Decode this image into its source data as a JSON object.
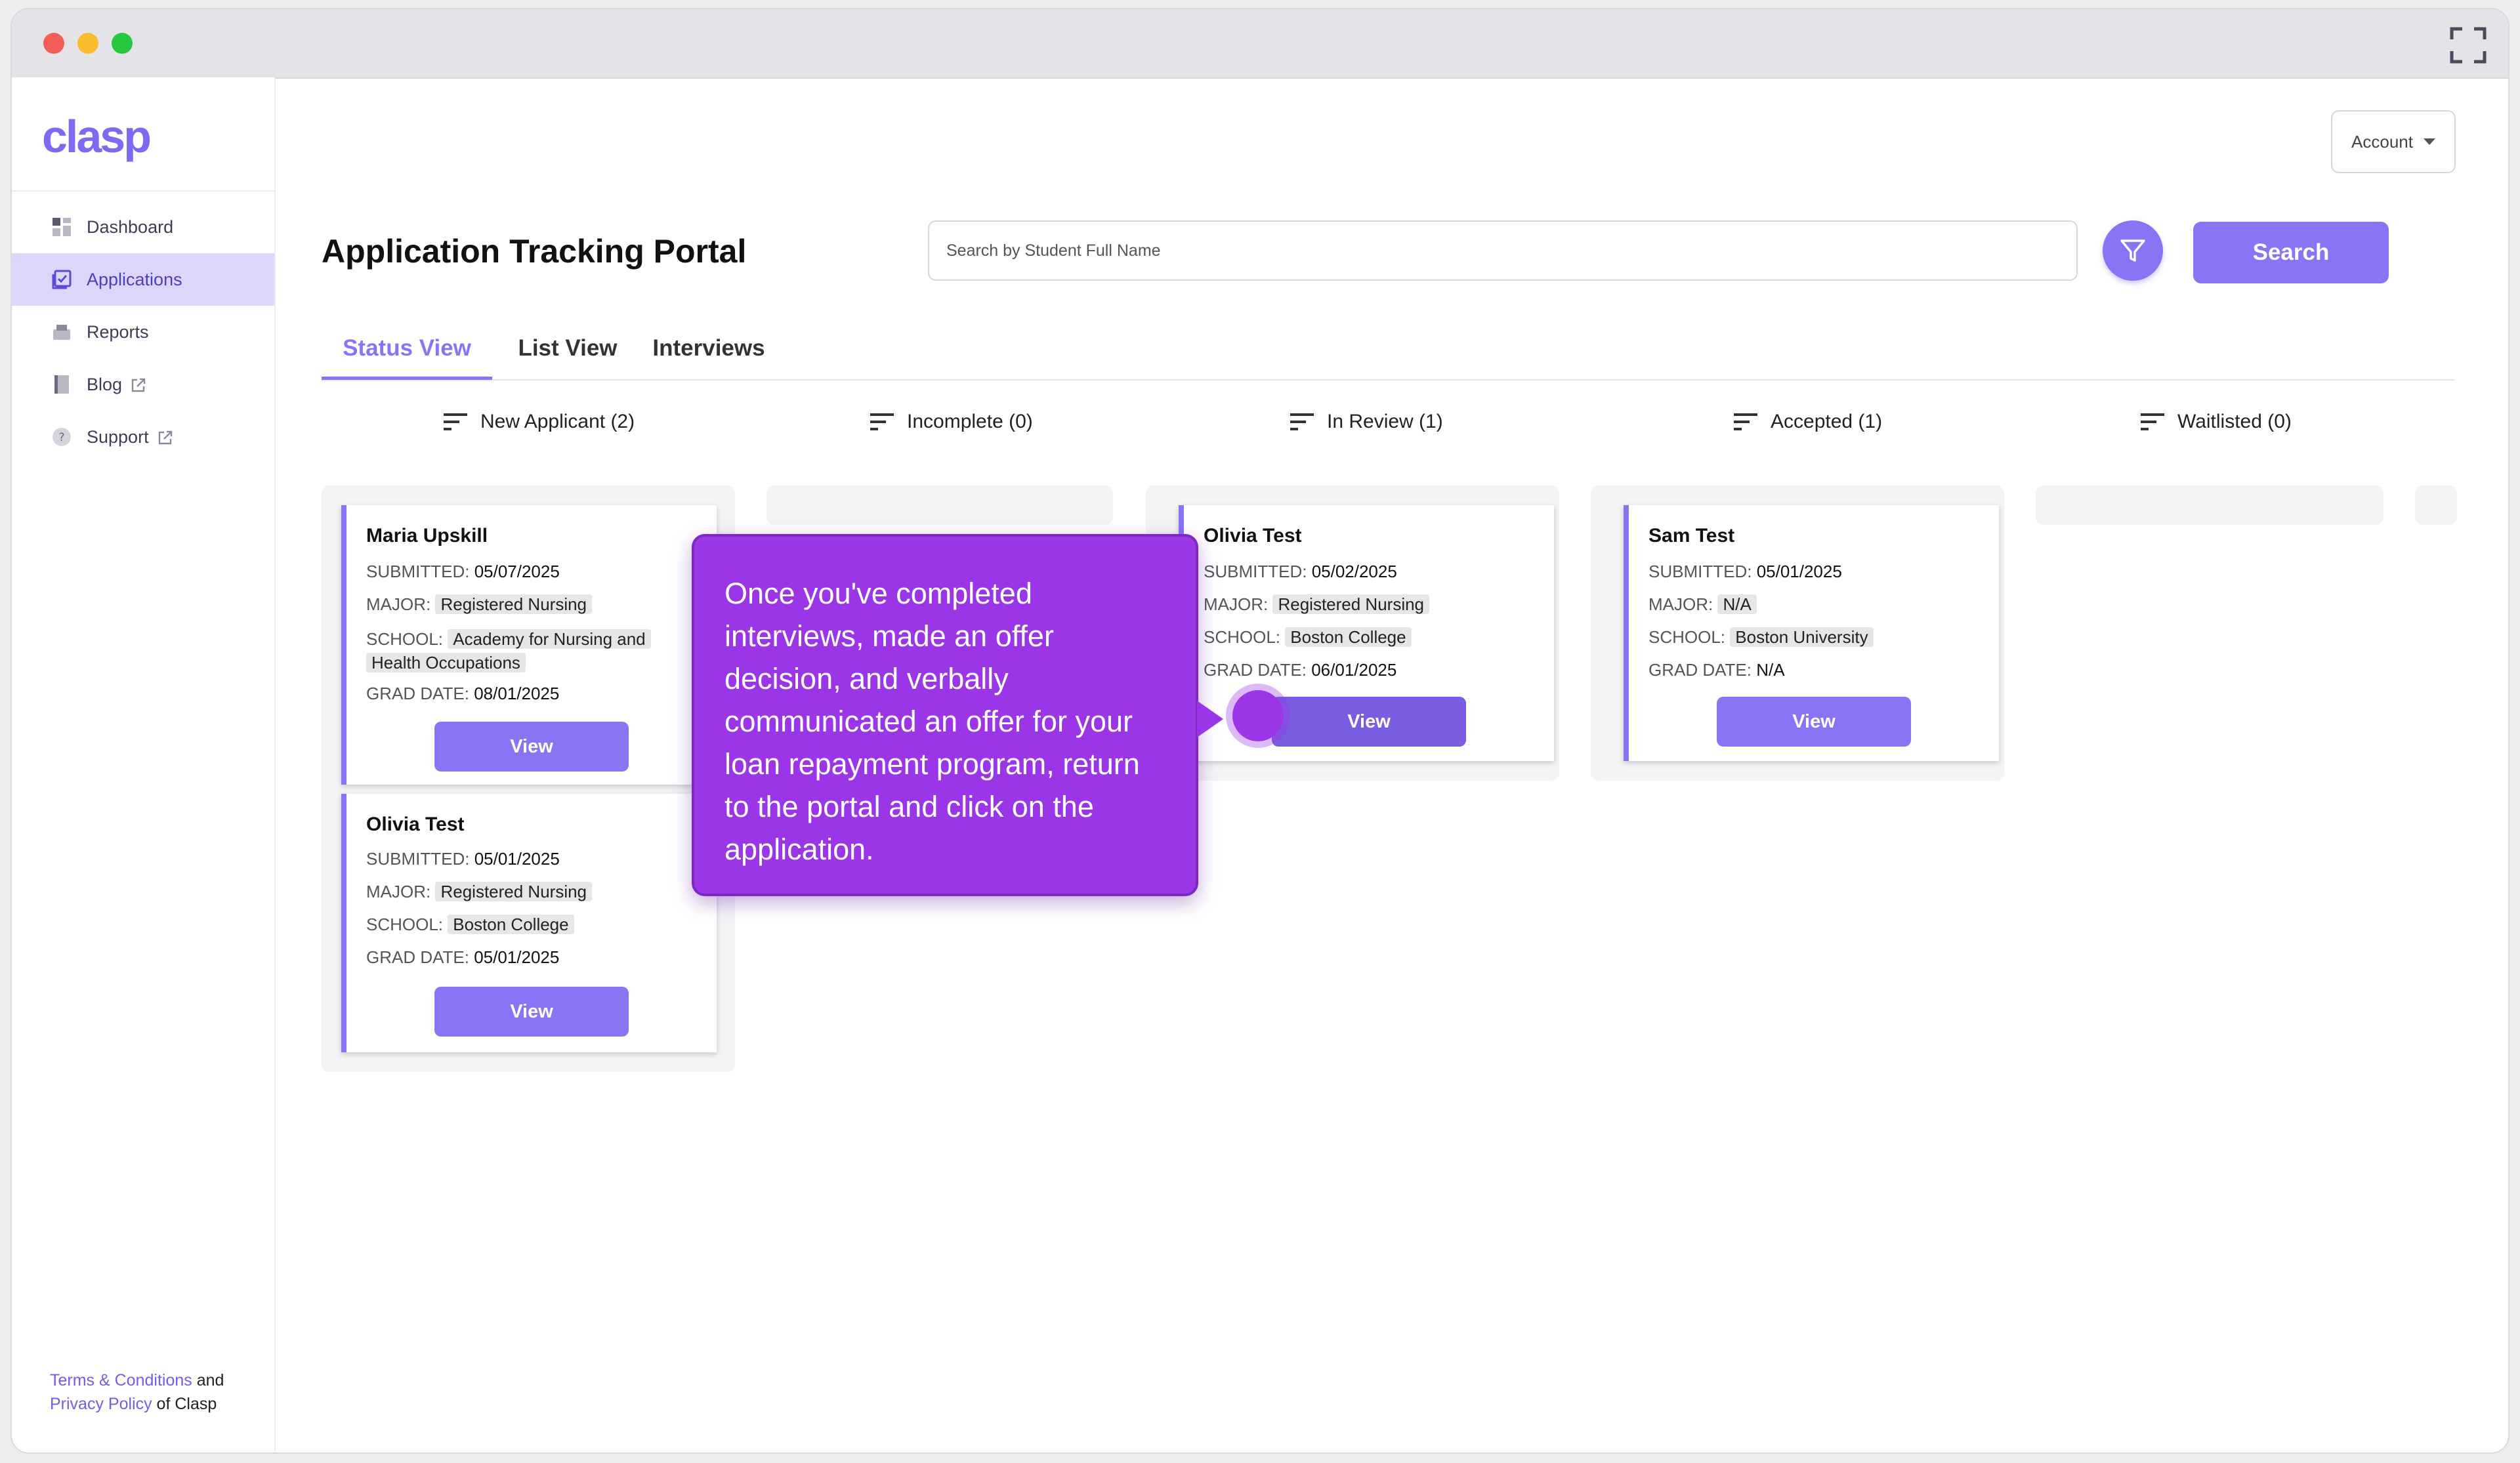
{
  "brand": {
    "logo": "clasp",
    "accent": "#8a73f5"
  },
  "window": {
    "dots": [
      "#f35f57",
      "#f7bd2e",
      "#27c840"
    ]
  },
  "sidebar": {
    "items": [
      {
        "label": "Dashboard",
        "icon": "dashboard-icon"
      },
      {
        "label": "Applications",
        "icon": "applications-icon",
        "active": true
      },
      {
        "label": "Reports",
        "icon": "reports-icon"
      },
      {
        "label": "Blog",
        "icon": "blog-icon",
        "external": true
      },
      {
        "label": "Support",
        "icon": "support-icon",
        "external": true
      }
    ],
    "footer": {
      "terms": "Terms & Conditions",
      "and": "and",
      "privacy": "Privacy Policy",
      "suffix": "of Clasp"
    }
  },
  "header": {
    "account_label": "Account",
    "title": "Application Tracking Portal",
    "search_placeholder": "Search by Student Full Name",
    "search_button": "Search"
  },
  "tabs": [
    {
      "label": "Status View",
      "active": true
    },
    {
      "label": "List View"
    },
    {
      "label": "Interviews"
    }
  ],
  "columns": [
    {
      "title": "New Applicant (2)"
    },
    {
      "title": "Incomplete (0)"
    },
    {
      "title": "In Review (1)"
    },
    {
      "title": "Accepted (1)"
    },
    {
      "title": "Waitlisted (0)"
    }
  ],
  "field_labels": {
    "submitted": "SUBMITTED:",
    "major": "MAJOR:",
    "school": "SCHOOL:",
    "grad": "GRAD DATE:"
  },
  "cards": [
    {
      "name": "Maria Upskill",
      "submitted": "05/07/2025",
      "major": "Registered Nursing",
      "school_line1": "Academy for Nursing and",
      "school_line2": "Health Occupations",
      "grad": "08/01/2025",
      "view": "View"
    },
    {
      "name": "Olivia Test",
      "submitted": "05/01/2025",
      "major": "Registered Nursing",
      "school": "Boston College",
      "grad": "05/01/2025",
      "view": "View"
    },
    {
      "name": "Olivia Test",
      "submitted": "05/02/2025",
      "major": "Registered Nursing",
      "school": "Boston College",
      "grad": "06/01/2025",
      "view": "View"
    },
    {
      "name": "Sam Test",
      "submitted": "05/01/2025",
      "major": "N/A",
      "school": "Boston University",
      "grad": "N/A",
      "view": "View"
    }
  ],
  "tooltip": {
    "text": "Once you've completed interviews, made an offer decision, and verbally communicated an offer for your loan repayment program, return to the portal and click on the application."
  }
}
